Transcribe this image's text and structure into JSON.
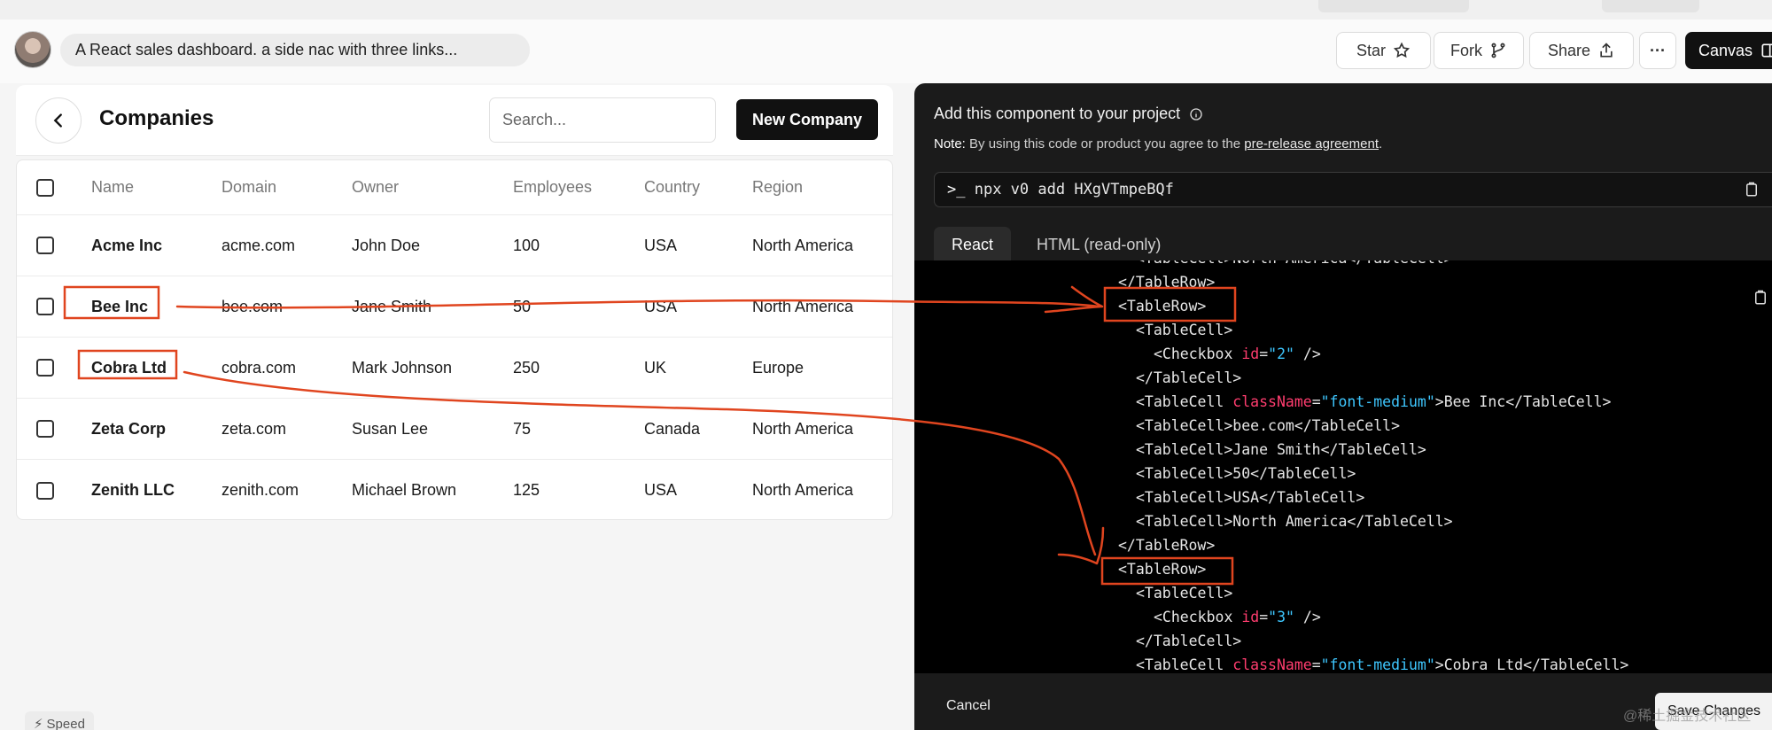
{
  "prompt": {
    "text": "A React sales dashboard. a side nac with three links..."
  },
  "toolbar": {
    "star_label": "Star",
    "fork_label": "Fork",
    "share_label": "Share",
    "more_label": "···",
    "canvas_label": "Canvas"
  },
  "companies": {
    "title": "Companies",
    "search_placeholder": "Search...",
    "new_button": "New Company",
    "columns": [
      "Name",
      "Domain",
      "Owner",
      "Employees",
      "Country",
      "Region"
    ],
    "rows": [
      [
        "Acme Inc",
        "acme.com",
        "John Doe",
        "100",
        "USA",
        "North America"
      ],
      [
        "Bee Inc",
        "bee.com",
        "Jane Smith",
        "50",
        "USA",
        "North America"
      ],
      [
        "Cobra Ltd",
        "cobra.com",
        "Mark Johnson",
        "250",
        "UK",
        "Europe"
      ],
      [
        "Zeta Corp",
        "zeta.com",
        "Susan Lee",
        "75",
        "Canada",
        "North America"
      ],
      [
        "Zenith LLC",
        "zenith.com",
        "Michael Brown",
        "125",
        "USA",
        "North America"
      ]
    ]
  },
  "speed_label": "Speed",
  "install_panel": {
    "title": "Add this component to your project",
    "note_label": "Note:",
    "note_text": "By using this code or product you agree to the",
    "note_link": "pre-release agreement",
    "note_end": ".",
    "command": "npx v0 add HXgVTmpeBQf",
    "tabs": [
      "React",
      "HTML (read-only)"
    ],
    "cancel_label": "Cancel",
    "save_label": "Save Changes"
  },
  "code_lines": [
    {
      "indent": 2,
      "parts": [
        {
          "t": "<TableCell>North America</TableCell>"
        }
      ]
    },
    {
      "indent": 1,
      "parts": [
        {
          "t": "</TableRow>"
        }
      ]
    },
    {
      "indent": 1,
      "parts": [
        {
          "t": "<TableRow>"
        }
      ]
    },
    {
      "indent": 2,
      "parts": [
        {
          "t": "<TableCell>"
        }
      ]
    },
    {
      "indent": 3,
      "parts": [
        {
          "t": "<Checkbox "
        },
        {
          "t": "id",
          "c": "kw"
        },
        {
          "t": "="
        },
        {
          "t": "\"2\"",
          "c": "str"
        },
        {
          "t": " />"
        }
      ]
    },
    {
      "indent": 2,
      "parts": [
        {
          "t": "</TableCell>"
        }
      ]
    },
    {
      "indent": 2,
      "parts": [
        {
          "t": "<TableCell "
        },
        {
          "t": "className",
          "c": "kw"
        },
        {
          "t": "="
        },
        {
          "t": "\"font-medium\"",
          "c": "str"
        },
        {
          "t": ">Bee Inc</TableCell>"
        }
      ]
    },
    {
      "indent": 2,
      "parts": [
        {
          "t": "<TableCell>bee.com</TableCell>"
        }
      ]
    },
    {
      "indent": 2,
      "parts": [
        {
          "t": "<TableCell>Jane Smith</TableCell>"
        }
      ]
    },
    {
      "indent": 2,
      "parts": [
        {
          "t": "<TableCell>50</TableCell>"
        }
      ]
    },
    {
      "indent": 2,
      "parts": [
        {
          "t": "<TableCell>USA</TableCell>"
        }
      ]
    },
    {
      "indent": 2,
      "parts": [
        {
          "t": "<TableCell>North America</TableCell>"
        }
      ]
    },
    {
      "indent": 1,
      "parts": [
        {
          "t": "</TableRow>"
        }
      ]
    },
    {
      "indent": 1,
      "parts": [
        {
          "t": "<TableRow>"
        }
      ]
    },
    {
      "indent": 2,
      "parts": [
        {
          "t": "<TableCell>"
        }
      ]
    },
    {
      "indent": 3,
      "parts": [
        {
          "t": "<Checkbox "
        },
        {
          "t": "id",
          "c": "kw"
        },
        {
          "t": "="
        },
        {
          "t": "\"3\"",
          "c": "str"
        },
        {
          "t": " />"
        }
      ]
    },
    {
      "indent": 2,
      "parts": [
        {
          "t": "</TableCell>"
        }
      ]
    },
    {
      "indent": 2,
      "parts": [
        {
          "t": "<TableCell "
        },
        {
          "t": "className",
          "c": "kw"
        },
        {
          "t": "="
        },
        {
          "t": "\"font-medium\"",
          "c": "str"
        },
        {
          "t": ">Cobra Ltd</TableCell>"
        }
      ]
    }
  ],
  "watermark": "@稀土掘金技术社区",
  "colors": {
    "annotation": "#e0451f",
    "keyword": "#ff3d6f",
    "string": "#3ec7ff",
    "panel_dark": "#1b1b1b",
    "button_dark": "#111111"
  }
}
